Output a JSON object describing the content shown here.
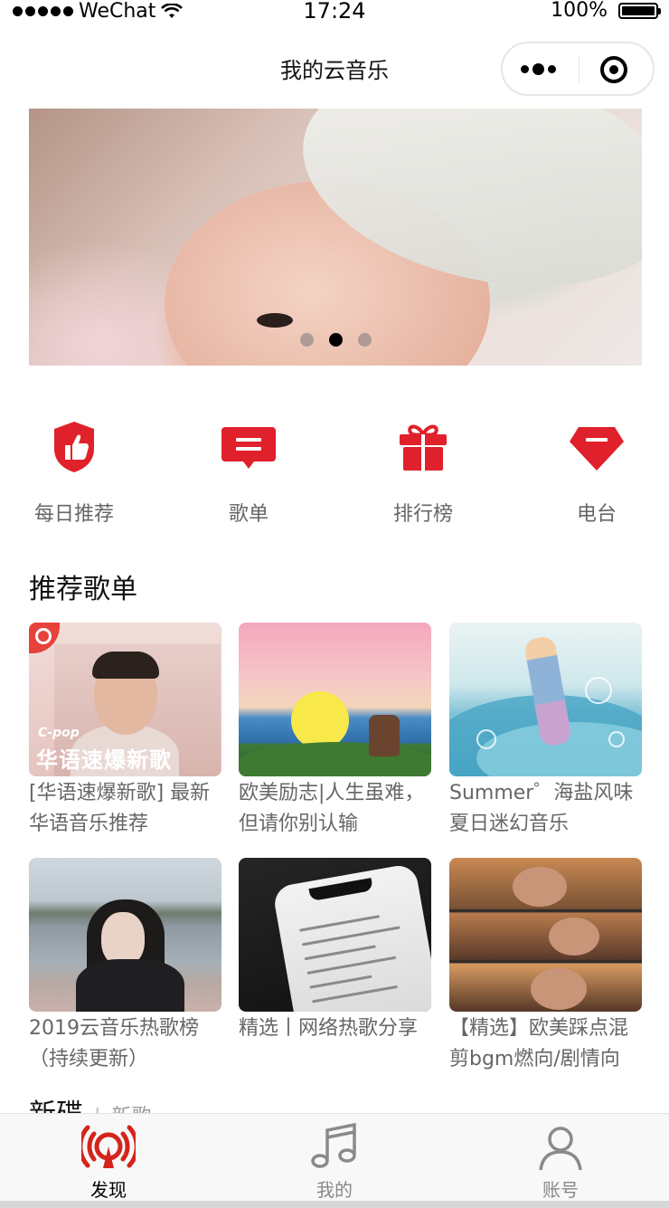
{
  "status_bar": {
    "carrier": "WeChat",
    "time": "17:24",
    "battery": "100%"
  },
  "nav": {
    "title": "我的云音乐"
  },
  "banner": {
    "dots": 3,
    "active_dot": 1
  },
  "categories": [
    {
      "label": "每日推荐",
      "icon": "thumbs-up-shield-icon"
    },
    {
      "label": "歌单",
      "icon": "playlist-message-icon"
    },
    {
      "label": "排行榜",
      "icon": "gift-icon"
    },
    {
      "label": "电台",
      "icon": "radio-gem-icon"
    }
  ],
  "recommend": {
    "title": "推荐歌单",
    "playlists": [
      {
        "title": "[华语速爆新歌] 最新华语音乐推荐",
        "cover_tag": "C-pop",
        "cover_title": "华语速爆新歌"
      },
      {
        "title": "欧美励志|人生虽难，但请你别认输"
      },
      {
        "title": "Summer゜海盐风味 夏日迷幻音乐"
      },
      {
        "title": "2019云音乐热歌榜（持续更新）"
      },
      {
        "title": "精选丨网络热歌分享"
      },
      {
        "title": "【精选】欧美踩点混剪bgm燃向/剧情向"
      }
    ]
  },
  "new_section": {
    "title": "新碟",
    "separator": "|",
    "sub": "新歌"
  },
  "tabbar": {
    "tabs": [
      {
        "label": "发现",
        "icon": "discover-radio-icon",
        "active": true
      },
      {
        "label": "我的",
        "icon": "music-note-icon",
        "active": false
      },
      {
        "label": "账号",
        "icon": "user-icon",
        "active": false
      }
    ]
  },
  "colors": {
    "accent": "#e0202a",
    "tab_active": "#d4241c"
  }
}
